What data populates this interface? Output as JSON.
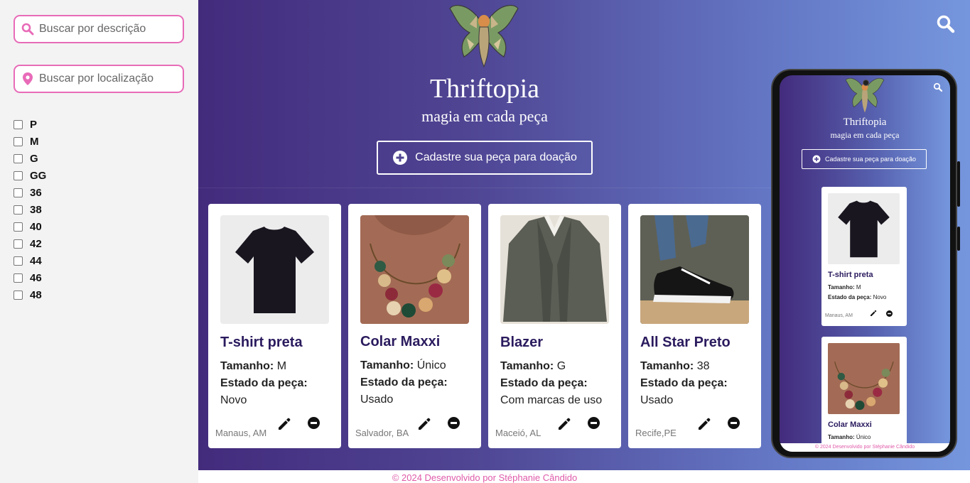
{
  "sidebar": {
    "search_description_placeholder": "Buscar por descrição",
    "search_location_placeholder": "Buscar por localização",
    "sizes": [
      "P",
      "M",
      "G",
      "GG",
      "36",
      "38",
      "40",
      "42",
      "44",
      "46",
      "48"
    ]
  },
  "header": {
    "title": "Thriftopia",
    "subtitle": "magia em cada peça",
    "cta_label": "Cadastre sua peça para doação"
  },
  "labels": {
    "size": "Tamanho:",
    "condition": "Estado da peça:"
  },
  "items": [
    {
      "title": "T-shirt preta",
      "size": "M",
      "condition": "Novo",
      "location": "Manaus, AM"
    },
    {
      "title": "Colar Maxxi",
      "size": "Único",
      "condition": "Usado",
      "location": "Salvador, BA"
    },
    {
      "title": "Blazer",
      "size": "G",
      "condition": "Com marcas de uso",
      "location": "Maceió, AL"
    },
    {
      "title": "All Star Preto",
      "size": "38",
      "condition": "Usado",
      "location": "Recife,PE"
    }
  ],
  "footer": "© 2024 Desenvolvido por Stéphanie Cândido",
  "colors": {
    "accent_pink": "#e86bb8",
    "title_purple": "#2b1b5e",
    "gradient_start": "#432b7c",
    "gradient_end": "#7596dd"
  },
  "icons": {
    "search": "magnifier-icon",
    "location": "pin-icon",
    "add": "plus-circle-icon",
    "edit": "pencil-icon",
    "remove": "minus-circle-icon"
  }
}
